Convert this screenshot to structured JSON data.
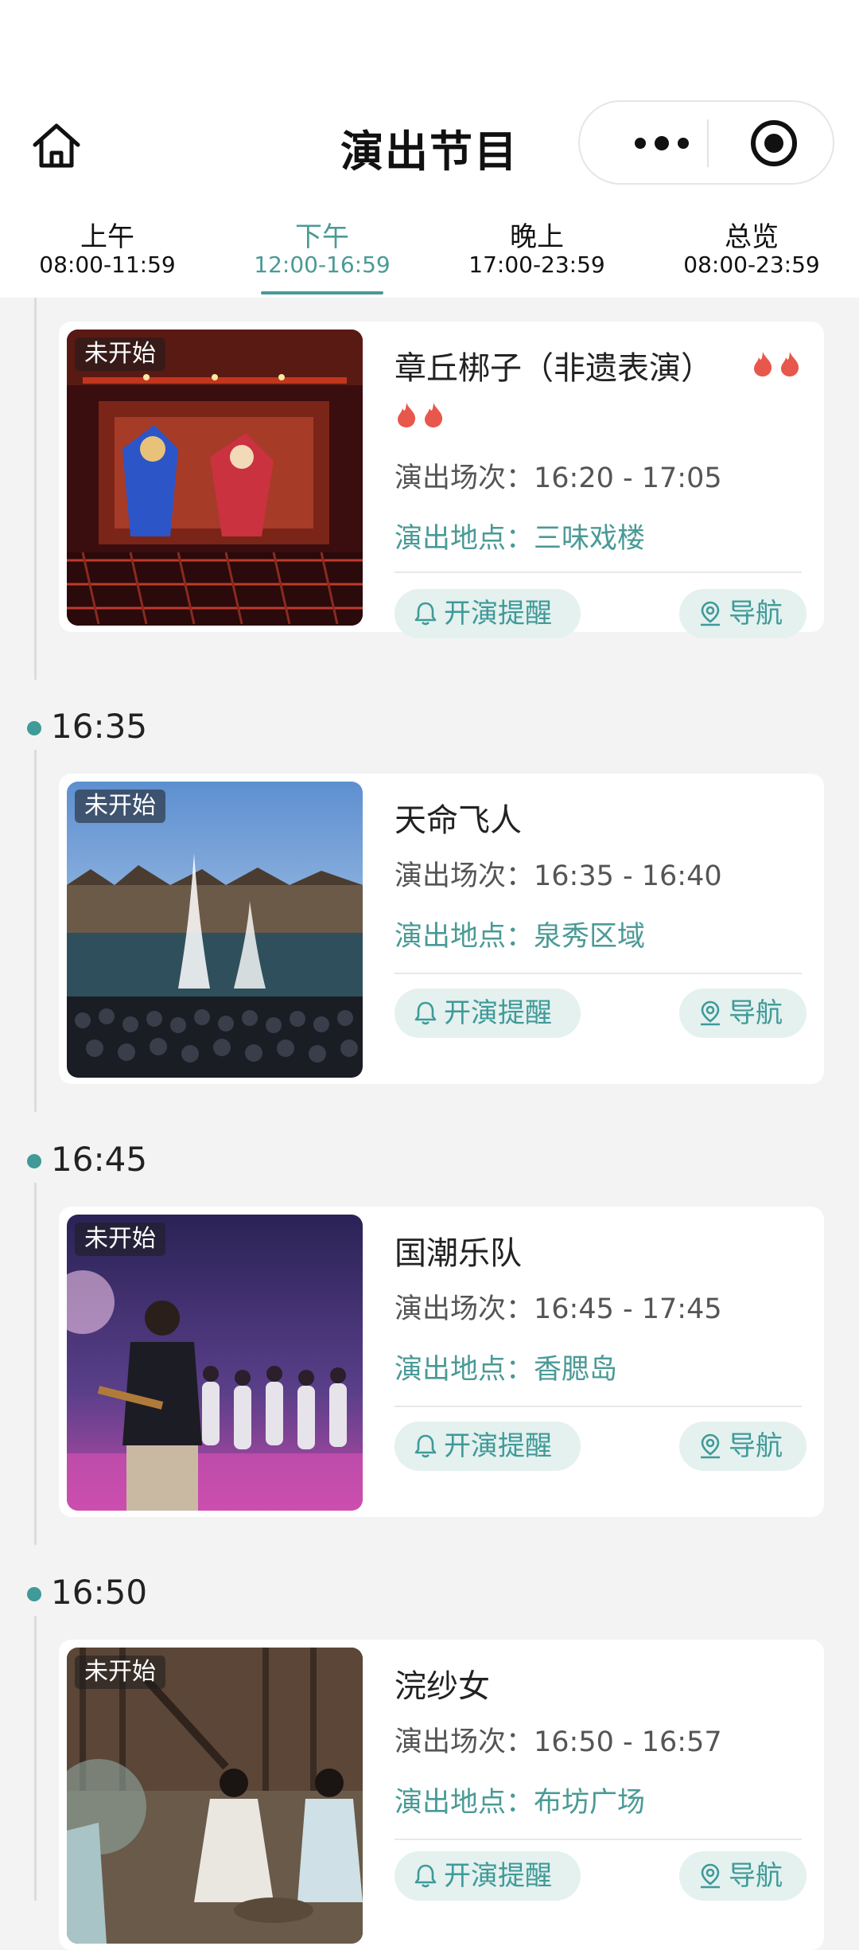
{
  "header": {
    "title": "演出节目"
  },
  "tabs": [
    {
      "name": "上午",
      "range": "08:00-11:59",
      "active": false
    },
    {
      "name": "下午",
      "range": "12:00-16:59",
      "active": true
    },
    {
      "name": "晚上",
      "range": "17:00-23:59",
      "active": false
    },
    {
      "name": "总览",
      "range": "08:00-23:59",
      "active": false
    }
  ],
  "shows": [
    {
      "time": "",
      "title": "章丘梆子（非遗表演）",
      "flames": 4,
      "status": "未开始",
      "session_label": "演出场次：",
      "session": "16:20 - 17:05",
      "venue_label": "演出地点：",
      "venue": "三味戏楼",
      "remind_label": "开演提醒",
      "nav_label": "导航"
    },
    {
      "time": "16:35",
      "title": "天命飞人",
      "flames": 0,
      "status": "未开始",
      "session_label": "演出场次：",
      "session": "16:35 - 16:40",
      "venue_label": "演出地点：",
      "venue": "泉秀区域",
      "remind_label": "开演提醒",
      "nav_label": "导航"
    },
    {
      "time": "16:45",
      "title": "国潮乐队",
      "flames": 0,
      "status": "未开始",
      "session_label": "演出场次：",
      "session": "16:45 - 17:45",
      "venue_label": "演出地点：",
      "venue": "香腮岛",
      "remind_label": "开演提醒",
      "nav_label": "导航"
    },
    {
      "time": "16:50",
      "title": "浣纱女",
      "flames": 0,
      "status": "未开始",
      "session_label": "演出场次：",
      "session": "16:50 - 16:57",
      "venue_label": "演出地点：",
      "venue": "布坊广场",
      "remind_label": "开演提醒",
      "nav_label": "导航"
    }
  ],
  "colors": {
    "accent": "#4a9a96",
    "button_bg": "#e4f1ef",
    "flame": "#e8574b"
  }
}
